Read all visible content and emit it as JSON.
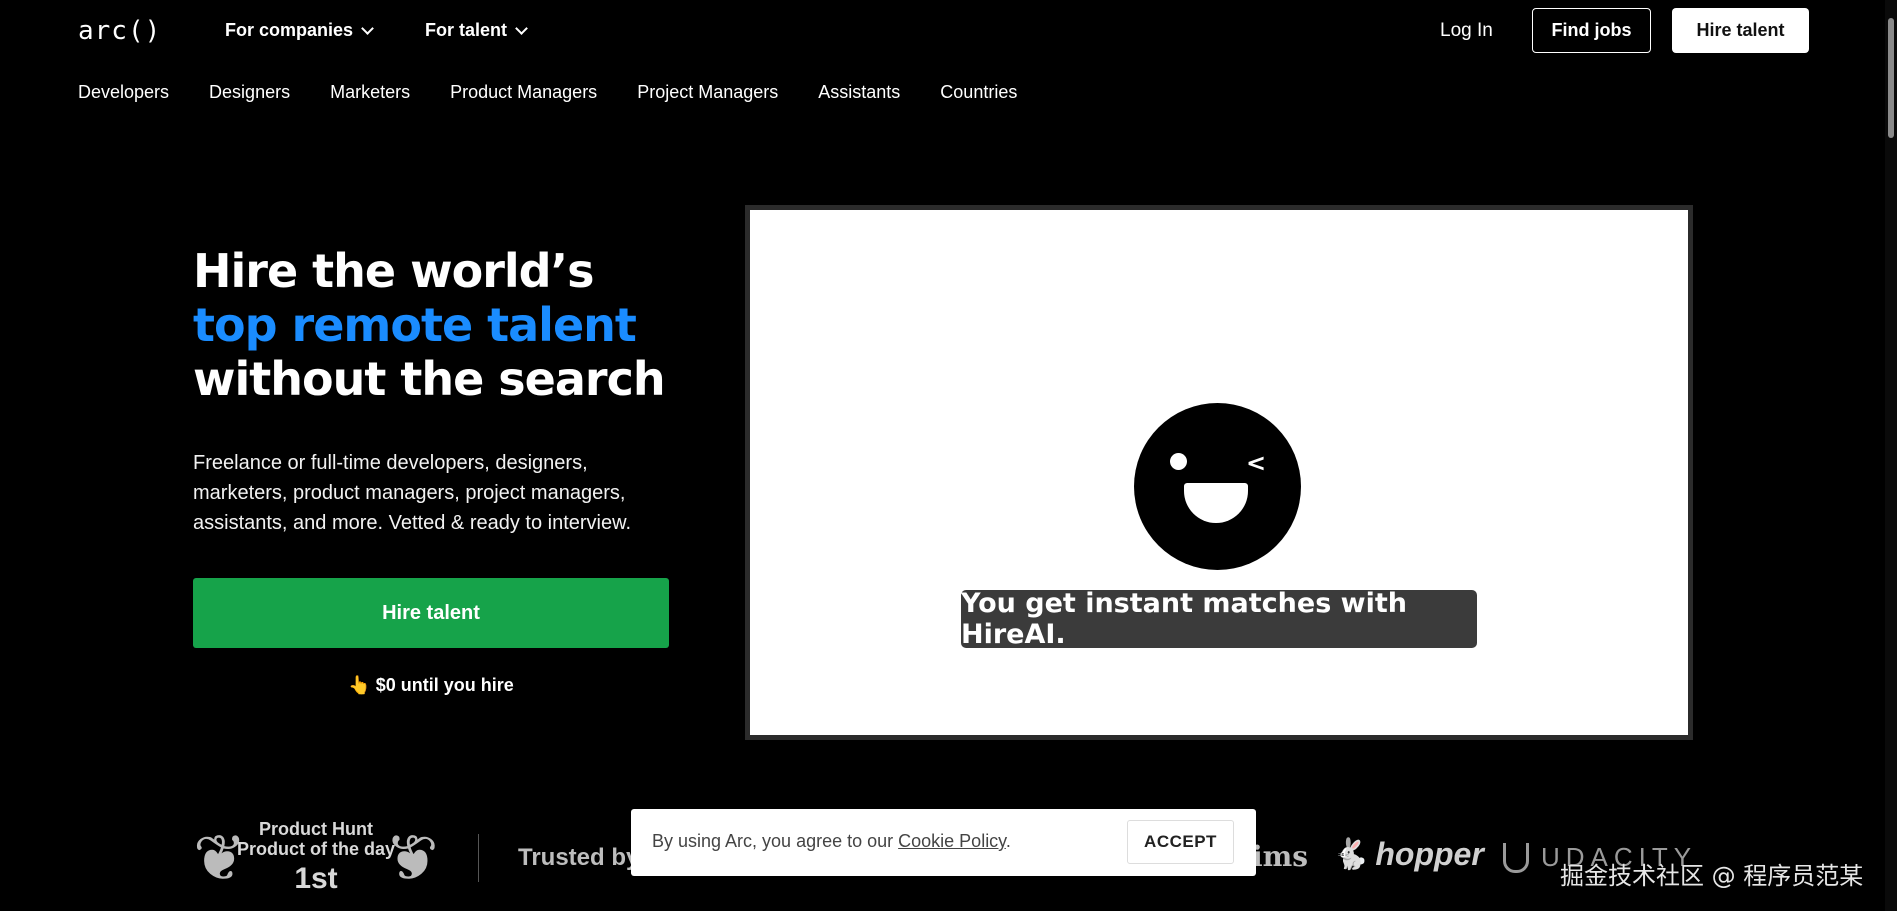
{
  "header": {
    "logo": "arc()",
    "nav": [
      {
        "label": "For companies"
      },
      {
        "label": "For talent"
      }
    ],
    "login": "Log In",
    "find_jobs": "Find jobs",
    "hire_talent": "Hire talent"
  },
  "subnav": [
    "Developers",
    "Designers",
    "Marketers",
    "Product Managers",
    "Project Managers",
    "Assistants",
    "Countries"
  ],
  "hero": {
    "title_line1": "Hire the world’s",
    "title_line2": "top remote talent",
    "title_line3": "without the search",
    "description": "Freelance or full-time developers, designers, marketers, product managers, project managers, assistants, and more. Vetted & ready to interview.",
    "cta": "Hire talent",
    "cta_note_emoji": "👆",
    "cta_note": "$0 until you hire"
  },
  "video": {
    "caption": "You get instant matches with HireAI."
  },
  "badge": {
    "line1": "Product Hunt",
    "line2": "Product of the day",
    "rank": "1st"
  },
  "trusted": {
    "label": "Trusted by",
    "logos": [
      "ims",
      "hopper",
      "UDACITY"
    ]
  },
  "cookie": {
    "text_prefix": "By using Arc, you agree to our ",
    "link": "Cookie Policy",
    "text_suffix": ".",
    "accept": "ACCEPT"
  },
  "watermark": "掘金技术社区 @ 程序员范某",
  "colors": {
    "background": "#000000",
    "accent": "#1a8cff",
    "cta": "#16a34a"
  }
}
